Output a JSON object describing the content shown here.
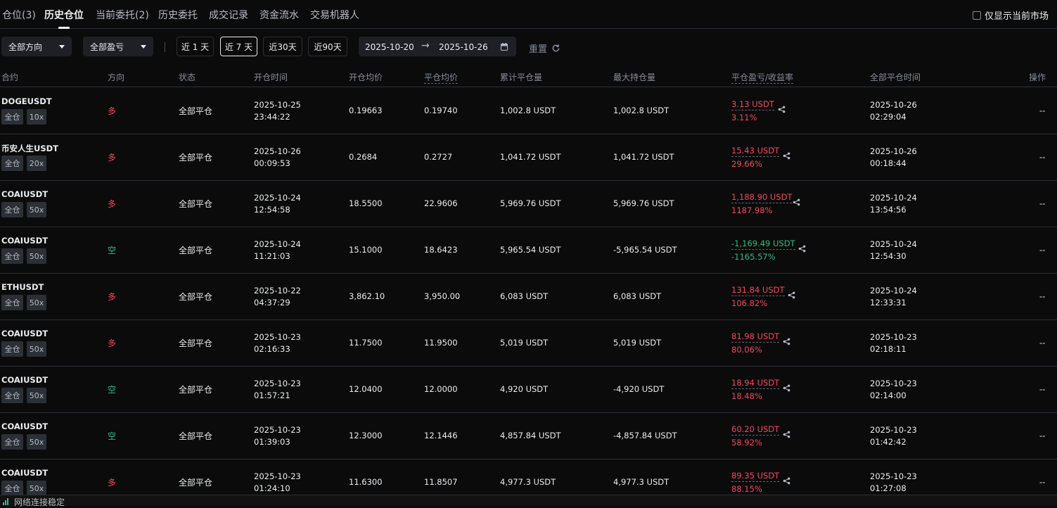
{
  "tabs": [
    {
      "label": "仓位(3)"
    },
    {
      "label": "历史仓位"
    },
    {
      "label": "当前委托(2)"
    },
    {
      "label": "历史委托"
    },
    {
      "label": "成交记录"
    },
    {
      "label": "资金流水"
    },
    {
      "label": "交易机器人"
    }
  ],
  "only_current_market": "仅显示当前市场",
  "filters": {
    "direction": "全部方向",
    "pnl": "全部盈亏",
    "ranges": [
      "近 1 天",
      "近 7 天",
      "近30天",
      "近90天"
    ],
    "active_range": "近 7 天",
    "date_start": "2025-10-20",
    "date_end": "2025-10-26",
    "reset": "重置"
  },
  "columns": {
    "contract": "合约",
    "direction": "方向",
    "status": "状态",
    "open_time": "开仓时间",
    "open_avg": "开仓均价",
    "close_avg": "平仓均价",
    "cum_closed": "累计平仓量",
    "max_position": "最大持仓量",
    "pnl": "平仓盈亏/收益率",
    "close_time": "全部平仓时间",
    "action": "操作"
  },
  "colors": {
    "long": "#f6465d",
    "short": "#2ebd85"
  },
  "rows": [
    {
      "symbol": "DOGEUSDT",
      "margin": "全仓",
      "leverage": "10x",
      "direction": "多",
      "side": "long",
      "status": "全部平仓",
      "open_date": "2025-10-25",
      "open_clock": "23:44:22",
      "open_avg": "0.19663",
      "close_avg": "0.19740",
      "cum_closed": "1,002.8 USDT",
      "max_position": "1,002.8 USDT",
      "pnl": "3.13 USDT",
      "roi": "3.11%",
      "close_date": "2025-10-26",
      "close_clock": "02:29:04",
      "action": "--"
    },
    {
      "symbol": "币安人生USDT",
      "margin": "全仓",
      "leverage": "20x",
      "direction": "多",
      "side": "long",
      "status": "全部平仓",
      "open_date": "2025-10-26",
      "open_clock": "00:09:53",
      "open_avg": "0.2684",
      "close_avg": "0.2727",
      "cum_closed": "1,041.72 USDT",
      "max_position": "1,041.72 USDT",
      "pnl": "15.43 USDT",
      "roi": "29.66%",
      "close_date": "2025-10-26",
      "close_clock": "00:18:44",
      "action": "--"
    },
    {
      "symbol": "COAIUSDT",
      "margin": "全仓",
      "leverage": "50x",
      "direction": "多",
      "side": "long",
      "status": "全部平仓",
      "open_date": "2025-10-24",
      "open_clock": "12:54:58",
      "open_avg": "18.5500",
      "close_avg": "22.9606",
      "cum_closed": "5,969.76 USDT",
      "max_position": "5,969.76 USDT",
      "pnl": "1,188.90 USDT",
      "roi": "1187.98%",
      "close_date": "2025-10-24",
      "close_clock": "13:54:56",
      "action": "--"
    },
    {
      "symbol": "COAIUSDT",
      "margin": "全仓",
      "leverage": "50x",
      "direction": "空",
      "side": "short",
      "status": "全部平仓",
      "open_date": "2025-10-24",
      "open_clock": "11:21:03",
      "open_avg": "15.1000",
      "close_avg": "18.6423",
      "cum_closed": "5,965.54 USDT",
      "max_position": "-5,965.54 USDT",
      "pnl": "-1,169.49 USDT",
      "roi": "-1165.57%",
      "close_date": "2025-10-24",
      "close_clock": "12:54:30",
      "action": "--"
    },
    {
      "symbol": "ETHUSDT",
      "margin": "全仓",
      "leverage": "50x",
      "direction": "多",
      "side": "long",
      "status": "全部平仓",
      "open_date": "2025-10-22",
      "open_clock": "04:37:29",
      "open_avg": "3,862.10",
      "close_avg": "3,950.00",
      "cum_closed": "6,083 USDT",
      "max_position": "6,083 USDT",
      "pnl": "131.84 USDT",
      "roi": "106.82%",
      "close_date": "2025-10-24",
      "close_clock": "12:33:31",
      "action": "--"
    },
    {
      "symbol": "COAIUSDT",
      "margin": "全仓",
      "leverage": "50x",
      "direction": "多",
      "side": "long",
      "status": "全部平仓",
      "open_date": "2025-10-23",
      "open_clock": "02:16:33",
      "open_avg": "11.7500",
      "close_avg": "11.9500",
      "cum_closed": "5,019 USDT",
      "max_position": "5,019 USDT",
      "pnl": "81.98 USDT",
      "roi": "80.06%",
      "close_date": "2025-10-23",
      "close_clock": "02:18:11",
      "action": "--"
    },
    {
      "symbol": "COAIUSDT",
      "margin": "全仓",
      "leverage": "50x",
      "direction": "空",
      "side": "short",
      "status": "全部平仓",
      "open_date": "2025-10-23",
      "open_clock": "01:57:21",
      "open_avg": "12.0400",
      "close_avg": "12.0000",
      "cum_closed": "4,920 USDT",
      "max_position": "-4,920 USDT",
      "pnl": "18.94 USDT",
      "roi": "18.48%",
      "close_date": "2025-10-23",
      "close_clock": "02:14:00",
      "action": "--"
    },
    {
      "symbol": "COAIUSDT",
      "margin": "全仓",
      "leverage": "50x",
      "direction": "空",
      "side": "short",
      "status": "全部平仓",
      "open_date": "2025-10-23",
      "open_clock": "01:39:03",
      "open_avg": "12.3000",
      "close_avg": "12.1446",
      "cum_closed": "4,857.84 USDT",
      "max_position": "-4,857.84 USDT",
      "pnl": "60.20 USDT",
      "roi": "58.92%",
      "close_date": "2025-10-23",
      "close_clock": "01:42:42",
      "action": "--"
    },
    {
      "symbol": "COAIUSDT",
      "margin": "全仓",
      "leverage": "50x",
      "direction": "多",
      "side": "long",
      "status": "全部平仓",
      "open_date": "2025-10-23",
      "open_clock": "01:24:10",
      "open_avg": "11.6300",
      "close_avg": "11.8507",
      "cum_closed": "4,977.3 USDT",
      "max_position": "4,977.3 USDT",
      "pnl": "89.35 USDT",
      "roi": "88.15%",
      "close_date": "2025-10-23",
      "close_clock": "01:27:08",
      "action": "--"
    }
  ],
  "statusbar": {
    "connection": "网络连接稳定"
  }
}
